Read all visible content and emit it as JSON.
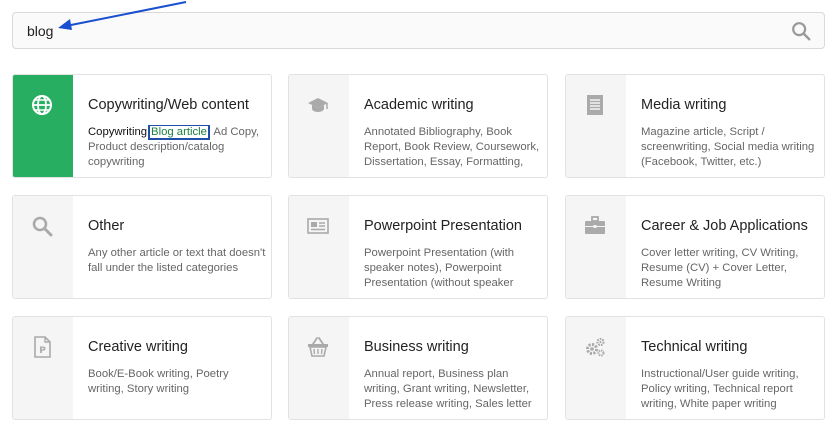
{
  "search": {
    "value": "blog"
  },
  "categories": [
    {
      "title": "Copywriting/Web content",
      "icon": "globe-icon",
      "active": true,
      "desc_highlight": "Copywriting",
      "desc_link": "Blog article",
      "desc_rest": " Ad Copy, Product description/catalog copywriting"
    },
    {
      "title": "Academic writing",
      "icon": "graduation-cap-icon",
      "desc": "Annotated Bibliography, Book Report, Book Review, Coursework, Dissertation, Essay, Formatting,"
    },
    {
      "title": "Media writing",
      "icon": "newspaper-icon",
      "desc": "Magazine article, Script / screenwriting, Social media writing (Facebook, Twitter, etc.)"
    },
    {
      "title": "Other",
      "icon": "search-icon",
      "desc": "Any other article or text that doesn't fall under the listed categories"
    },
    {
      "title": "Powerpoint Presentation",
      "icon": "presentation-icon",
      "desc": "Powerpoint Presentation (with speaker notes), Powerpoint Presentation (without speaker"
    },
    {
      "title": "Career & Job Applications",
      "icon": "briefcase-icon",
      "desc": "Cover letter writing, CV Writing, Resume (CV) + Cover Letter, Resume Writing"
    },
    {
      "title": "Creative writing",
      "icon": "document-p-icon",
      "desc": "Book/E-Book writing, Poetry writing, Story writing"
    },
    {
      "title": "Business writing",
      "icon": "basket-icon",
      "desc": "Annual report, Business plan writing, Grant writing, Newsletter, Press release writing, Sales letter"
    },
    {
      "title": "Technical writing",
      "icon": "gears-icon",
      "desc": "Instructional/User guide writing, Policy writing, Technical report writing, White paper writing"
    }
  ],
  "colors": {
    "accent": "#27ae60",
    "highlight_border": "#1f4fa8",
    "arrow": "#1a4fd0"
  }
}
